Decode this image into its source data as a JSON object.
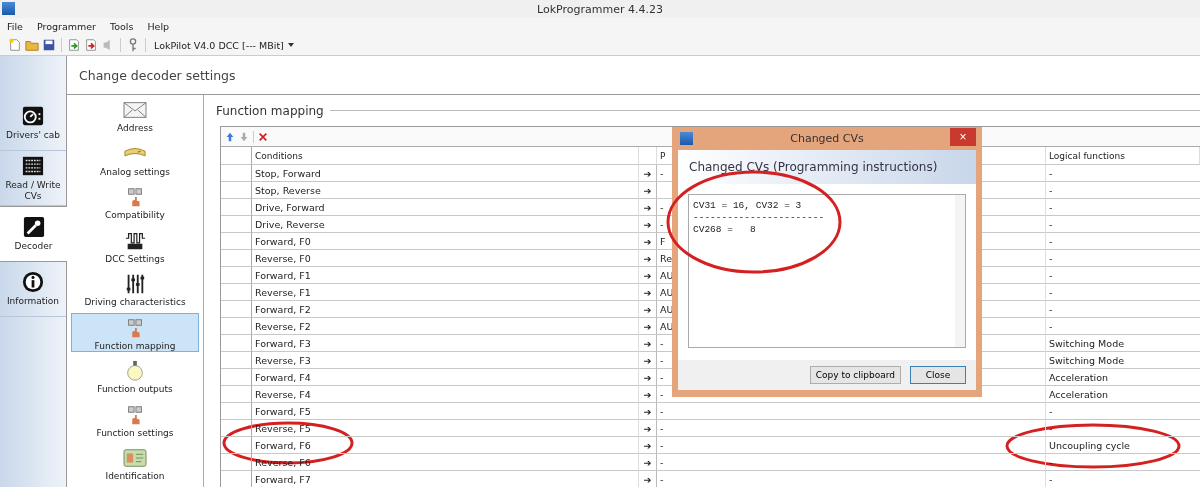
{
  "window": {
    "title": "LokProgrammer 4.4.23"
  },
  "menu": [
    "File",
    "Programmer",
    "Tools",
    "Help"
  ],
  "toolbar": {
    "decoder": "LokPilot V4.0 DCC [--- MBit]"
  },
  "nav_tabs": [
    {
      "label": "Drivers' cab",
      "selected": false
    },
    {
      "label": "Read / Write CVs",
      "selected": false
    },
    {
      "label": "Decoder",
      "selected": true
    },
    {
      "label": "Information",
      "selected": false
    }
  ],
  "page_title": "Change decoder settings",
  "settings_items": [
    {
      "label": "Address",
      "selected": false
    },
    {
      "label": "Analog settings",
      "selected": false
    },
    {
      "label": "Compatibility",
      "selected": false
    },
    {
      "label": "DCC Settings",
      "selected": false
    },
    {
      "label": "Driving characteristics",
      "selected": false
    },
    {
      "label": "Function mapping",
      "selected": true
    },
    {
      "label": "Function outputs",
      "selected": false
    },
    {
      "label": "Function settings",
      "selected": false
    },
    {
      "label": "Identification",
      "selected": false
    }
  ],
  "section_title": "Function mapping",
  "table": {
    "columns": [
      "Conditions",
      "P",
      "Logical functions"
    ],
    "rows": [
      {
        "condition": "Stop, Forward",
        "arrow": "➔",
        "column_2": "-",
        "logical": "-"
      },
      {
        "condition": "Stop, Reverse",
        "arrow": "➔",
        "logical": "-"
      },
      {
        "condition": "Drive, Forward",
        "arrow": "➔",
        "column_2": "-",
        "logical": "-"
      },
      {
        "condition": "Drive, Reverse",
        "arrow": "➔",
        "column_2": "-",
        "logical": "-"
      },
      {
        "condition": "Forward, F0",
        "arrow": "➔",
        "column_2": "F",
        "logical": "-"
      },
      {
        "condition": "Reverse, F0",
        "arrow": "➔",
        "column_2": "Re",
        "logical": "-"
      },
      {
        "condition": "Forward, F1",
        "arrow": "➔",
        "column_2": "AU",
        "logical": "-"
      },
      {
        "condition": "Reverse, F1",
        "arrow": "➔",
        "column_2": "AU",
        "logical": "-"
      },
      {
        "condition": "Forward, F2",
        "arrow": "➔",
        "column_2": "AU",
        "logical": "-"
      },
      {
        "condition": "Reverse, F2",
        "arrow": "➔",
        "column_2": "AU",
        "logical": "-"
      },
      {
        "condition": "Forward, F3",
        "arrow": "➔",
        "column_2": "-",
        "logical": "Switching Mode"
      },
      {
        "condition": "Reverse, F3",
        "arrow": "➔",
        "column_2": "-",
        "logical": "Switching Mode"
      },
      {
        "condition": "Forward, F4",
        "arrow": "➔",
        "column_2": "-",
        "logical": "Acceleration"
      },
      {
        "condition": "Reverse, F4",
        "arrow": "➔",
        "column_2": "-",
        "logical": "Acceleration"
      },
      {
        "condition": "Forward, F5",
        "arrow": "➔",
        "column_2": "-",
        "logical": "-"
      },
      {
        "condition": "Reverse, F5",
        "arrow": "➔",
        "column_2": "-",
        "logical": "-"
      },
      {
        "condition": "Forward, F6",
        "arrow": "➔",
        "column_2": "-",
        "logical": "Uncoupling cycle"
      },
      {
        "condition": "Reverse, F6",
        "arrow": "➔",
        "column_2": "-",
        "logical": "-"
      },
      {
        "condition": "Forward, F7",
        "arrow": "➔",
        "column_2": "-",
        "logical": "-"
      }
    ]
  },
  "dialog": {
    "title": "Changed CVs",
    "close": "×",
    "heading": "Changed CVs (Programming instructions)",
    "lines": [
      "CV31 = 16, CV32 = 3",
      "-----------------------",
      "CV268 =   8"
    ],
    "buttons": [
      "Copy to clipboard",
      "Close"
    ]
  }
}
